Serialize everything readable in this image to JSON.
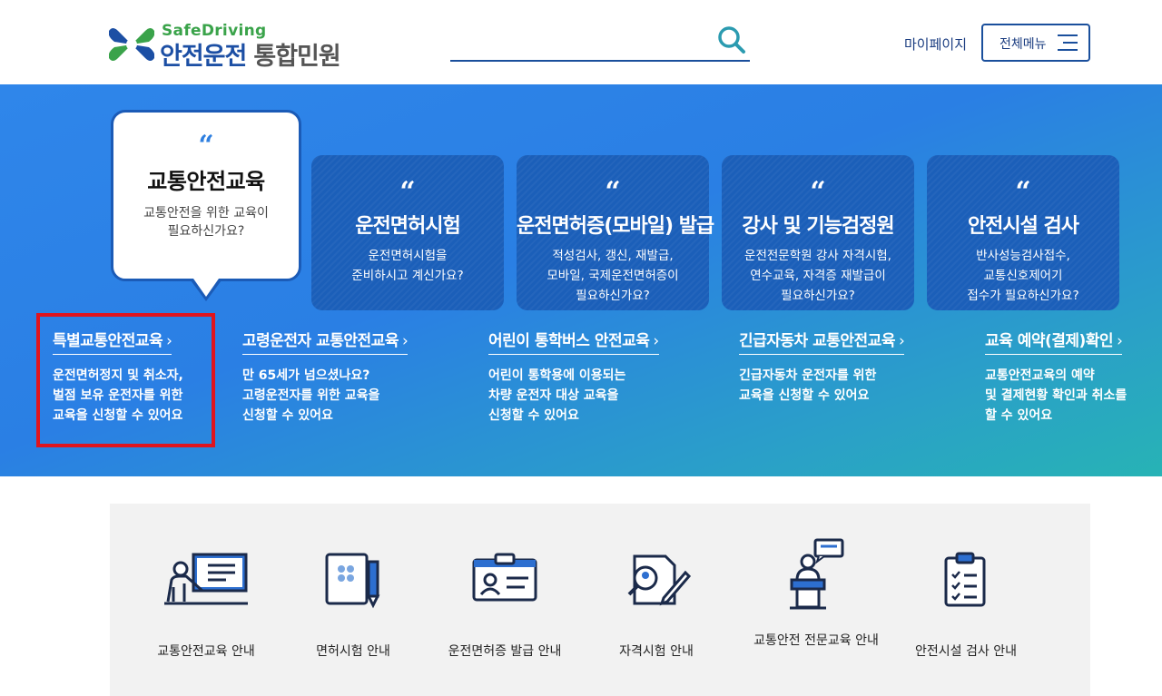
{
  "header": {
    "logo_sub": "SafeDriving",
    "logo_main": "안전운전",
    "logo_suffix": "통합민원",
    "search_placeholder": "",
    "mypage": "마이페이지",
    "all_menu": "전체메뉴"
  },
  "colors": {
    "brand_blue": "#1c4fa4",
    "brand_green": "#3aa34a",
    "highlight_red": "#e0141e"
  },
  "hero": {
    "bubble": {
      "quote": "“",
      "title": "교통안전교육",
      "desc": [
        "교통안전을 위한 교육이",
        "필요하신가요?"
      ]
    },
    "cards": [
      {
        "quote": "“",
        "title": "운전면허시험",
        "desc": [
          "운전면허시험을",
          "준비하시고 계신가요?"
        ]
      },
      {
        "quote": "“",
        "title": "운전면허증(모바일) 발급",
        "desc": [
          "적성검사, 갱신, 재발급,",
          "모바일, 국제운전면허증이",
          "필요하신가요?"
        ]
      },
      {
        "quote": "“",
        "title": "강사 및 기능검정원",
        "desc": [
          "운전전문학원 강사 자격시험,",
          "연수교육, 자격증 재발급이",
          "필요하신가요?"
        ]
      },
      {
        "quote": "“",
        "title": "안전시설 검사",
        "desc": [
          "반사성능검사접수,",
          "교통신호제어기",
          "접수가 필요하신가요?"
        ]
      }
    ],
    "links": [
      {
        "title": "특별교통안전교육",
        "desc": [
          "운전면허정지 및 취소자,",
          "벌점 보유 운전자를 위한",
          "교육을 신청할 수 있어요"
        ]
      },
      {
        "title": "고령운전자 교통안전교육",
        "desc": [
          "만 65세가 넘으셨나요?",
          "고령운전자를 위한 교육을",
          "신청할 수 있어요"
        ]
      },
      {
        "title": "어린이 통학버스 안전교육",
        "desc": [
          "어린이 통학용에 이용되는",
          "차량 운전자 대상 교육을",
          "신청할 수 있어요"
        ]
      },
      {
        "title": "긴급자동차 교통안전교육",
        "desc": [
          "긴급자동차 운전자를 위한",
          "교육을 신청할 수 있어요"
        ]
      },
      {
        "title": "교육 예약(결제)확인",
        "desc": [
          "교통안전교육의 예약",
          "및 결제현황 확인과 취소를",
          "할 수 있어요"
        ]
      }
    ],
    "chevron": "›"
  },
  "services": [
    {
      "label": "교통안전교육 안내",
      "icon": "lecture-icon"
    },
    {
      "label": "면허시험 안내",
      "icon": "license-exam-icon"
    },
    {
      "label": "운전면허증 발급 안내",
      "icon": "id-card-icon"
    },
    {
      "label": "자격시험 안내",
      "icon": "qualification-exam-icon"
    },
    {
      "label": "교통안전 전문교육 안내",
      "icon": "speaker-podium-icon"
    },
    {
      "label": "안전시설 검사 안내",
      "icon": "checklist-icon"
    }
  ]
}
